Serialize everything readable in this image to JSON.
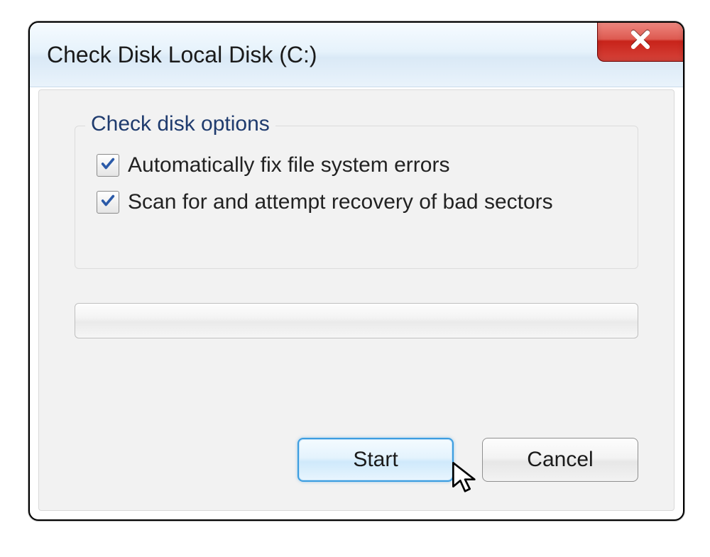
{
  "window": {
    "title": "Check Disk Local Disk (C:)"
  },
  "group": {
    "legend": "Check disk options",
    "options": [
      {
        "label": "Automatically fix file system errors",
        "checked": true
      },
      {
        "label": "Scan for and attempt recovery of bad sectors",
        "checked": true
      }
    ]
  },
  "progress": {
    "value": 0
  },
  "buttons": {
    "start": "Start",
    "cancel": "Cancel"
  }
}
